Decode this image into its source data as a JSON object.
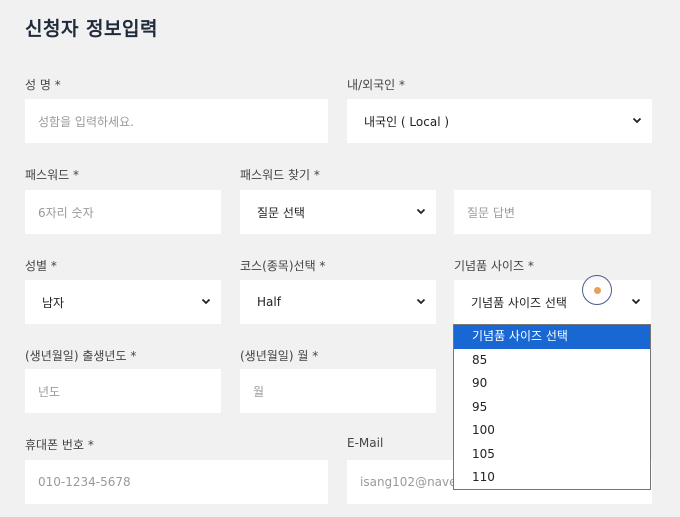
{
  "form": {
    "title": "신청자 정보입력",
    "name_label": "성 명 *",
    "name_placeholder": "성함을 입력하세요.",
    "nationality_label": "내/외국인 *",
    "nationality_value": "내국인 ( Local )",
    "password_label": "패스워드 *",
    "password_placeholder": "6자리 숫자",
    "password_find_label": "패스워드 찾기 *",
    "question_value": "질문 선택",
    "answer_placeholder": "질문 답변",
    "gender_label": "성별 *",
    "gender_value": "남자",
    "course_label": "코스(종목)선택 *",
    "course_value": "Half",
    "souvenir_label": "기념품 사이즈 *",
    "souvenir_value": "기념품 사이즈 선택",
    "birth_year_label": "(생년월일) 출생년도 *",
    "birth_year_placeholder": "년도",
    "birth_month_label": "(생년월일) 월 *",
    "birth_month_placeholder": "월",
    "phone_label": "휴대폰 번호 *",
    "phone_placeholder": "010-1234-5678",
    "email_label": "E-Mail",
    "email_placeholder": "isang102@naver"
  },
  "souvenir_options": [
    "기념품 사이즈 선택",
    "85",
    "90",
    "95",
    "100",
    "105",
    "110"
  ],
  "icons": {
    "select_arrow": "chevron-down-icon",
    "cursor": "pointer-indicator"
  },
  "colors": {
    "selected_option": "#1967d2",
    "page_bg": "#f1f1f1",
    "field_bg": "#ffffff"
  }
}
